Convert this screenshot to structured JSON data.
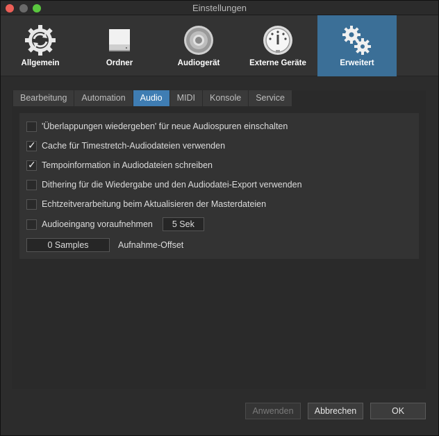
{
  "window": {
    "title": "Einstellungen"
  },
  "toolbar": {
    "items": [
      {
        "label": "Allgemein",
        "icon": "sync-gear-icon"
      },
      {
        "label": "Ordner",
        "icon": "drive-icon"
      },
      {
        "label": "Audiogerät",
        "icon": "speaker-icon"
      },
      {
        "label": "Externe Geräte",
        "icon": "midi-port-icon"
      },
      {
        "label": "Erweitert",
        "icon": "gears-icon",
        "active": true
      }
    ]
  },
  "tabs": [
    "Bearbeitung",
    "Automation",
    "Audio",
    "MIDI",
    "Konsole",
    "Service"
  ],
  "active_tab": "Audio",
  "options": [
    {
      "label": "'Überlappungen wiedergeben' für neue Audiospuren einschalten",
      "checked": false
    },
    {
      "label": "Cache für Timestretch-Audiodateien verwenden",
      "checked": true
    },
    {
      "label": "Tempoinformation in Audiodateien schreiben",
      "checked": true
    },
    {
      "label": "Dithering für die Wiedergabe und den Audiodatei-Export verwenden",
      "checked": false
    },
    {
      "label": "Echtzeitverarbeitung beim Aktualisieren der Masterdateien",
      "checked": false
    },
    {
      "label": "Audioeingang voraufnehmen",
      "checked": false,
      "value": "5 Sek"
    }
  ],
  "offset": {
    "value": "0 Samples",
    "label": "Aufnahme-Offset"
  },
  "buttons": {
    "apply": "Anwenden",
    "cancel": "Abbrechen",
    "ok": "OK"
  },
  "colors": {
    "accent": "#3f7db3",
    "toolbar_active": "#3b6f97"
  }
}
